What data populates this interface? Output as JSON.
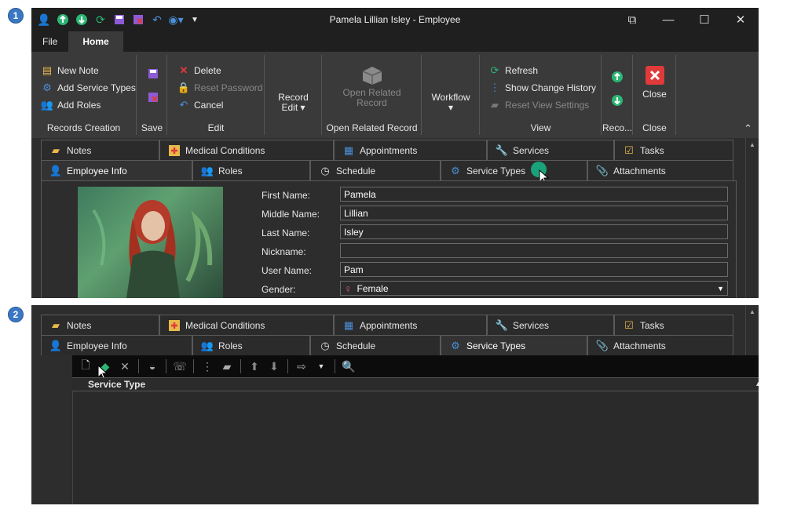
{
  "badges": [
    "1",
    "2"
  ],
  "window": {
    "title": "Pamela Lillian Isley - Employee",
    "controls": {
      "restore": "⧉",
      "minimize": "—",
      "maximize": "☐",
      "close": "✕"
    }
  },
  "menu": {
    "file": "File",
    "home": "Home"
  },
  "ribbon": {
    "records_creation": {
      "label": "Records Creation",
      "new_note": "New Note",
      "add_service_types": "Add Service Types",
      "add_roles": "Add Roles"
    },
    "save": {
      "label": "Save"
    },
    "edit": {
      "label": "Edit",
      "delete": "Delete",
      "reset_password": "Reset Password",
      "cancel": "Cancel"
    },
    "record_edit": {
      "line1": "Record",
      "line2": "Edit ▾"
    },
    "open_related": {
      "label": "Open Related Record",
      "line1": "Open Related",
      "line2": "Record"
    },
    "workflow": {
      "label": "Workflow",
      "arrow": "▾"
    },
    "view": {
      "label": "View",
      "refresh": "Refresh",
      "show_change_history": "Show Change History",
      "reset_view_settings": "Reset View Settings"
    },
    "reco": {
      "label": "Reco..."
    },
    "close": {
      "label": "Close",
      "button": "Close"
    },
    "collapse": "⌃"
  },
  "tabs": {
    "row1": [
      "Notes",
      "Medical Conditions",
      "Appointments",
      "Services",
      "Tasks"
    ],
    "row2": [
      "Employee Info",
      "Roles",
      "Schedule",
      "Service Types",
      "Attachments"
    ]
  },
  "form": {
    "first_name_label": "First Name:",
    "first_name": "Pamela",
    "middle_name_label": "Middle Name:",
    "middle_name": "Lillian",
    "last_name_label": "Last Name:",
    "last_name": "Isley",
    "nickname_label": "Nickname:",
    "nickname": "",
    "user_name_label": "User Name:",
    "user_name": "Pam",
    "gender_label": "Gender:",
    "gender": "Female",
    "gender_symbol": "♀"
  },
  "service_types_grid": {
    "column": "Service Type",
    "sort_glyph": "▲"
  },
  "colors": {
    "accent_green": "#2bb673",
    "cursor_highlight": "#1aa37a",
    "close_red": "#e03a3a",
    "icon_blue": "#4a8fd8",
    "icon_purple": "#8e5bd6",
    "female_pink": "#e05aa0"
  }
}
